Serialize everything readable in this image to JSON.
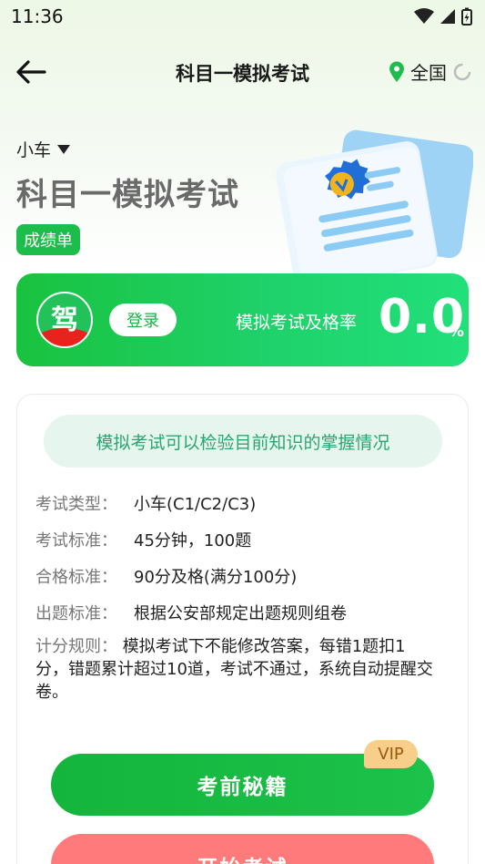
{
  "status": {
    "time": "11:36"
  },
  "nav": {
    "title": "科目一模拟考试",
    "region": "全国"
  },
  "hero": {
    "vehicle": "小车",
    "title": "科目一模拟考试",
    "score_tag": "成绩单"
  },
  "pass_card": {
    "logo_char": "驾",
    "login_label": "登录",
    "rate_label": "模拟考试及格率",
    "rate_value": "0.0",
    "rate_unit": "%"
  },
  "info": {
    "hint": "模拟考试可以检验目前知识的掌握情况",
    "rules": [
      {
        "key": "考试类型：",
        "value": "小车(C1/C2/C3)"
      },
      {
        "key": "考试标准：",
        "value": "45分钟，100题"
      },
      {
        "key": "合格标准：",
        "value": "90分及格(满分100分)"
      },
      {
        "key": "出题标准：",
        "value": "根据公安部规定出题规则组卷"
      }
    ],
    "scoring_key": "计分规则：",
    "scoring_value": "模拟考试下不能修改答案，每错1题扣1分，错题累计超过10道，考试不通过，系统自动提醒交卷。"
  },
  "actions": {
    "tips_label": "考前秘籍",
    "vip_label": "VIP",
    "start_label": "开始考试"
  },
  "colors": {
    "brand_green": "#1cbd4a",
    "start_red": "#ff7b7b",
    "vip_gold": "#f7cf8a"
  }
}
